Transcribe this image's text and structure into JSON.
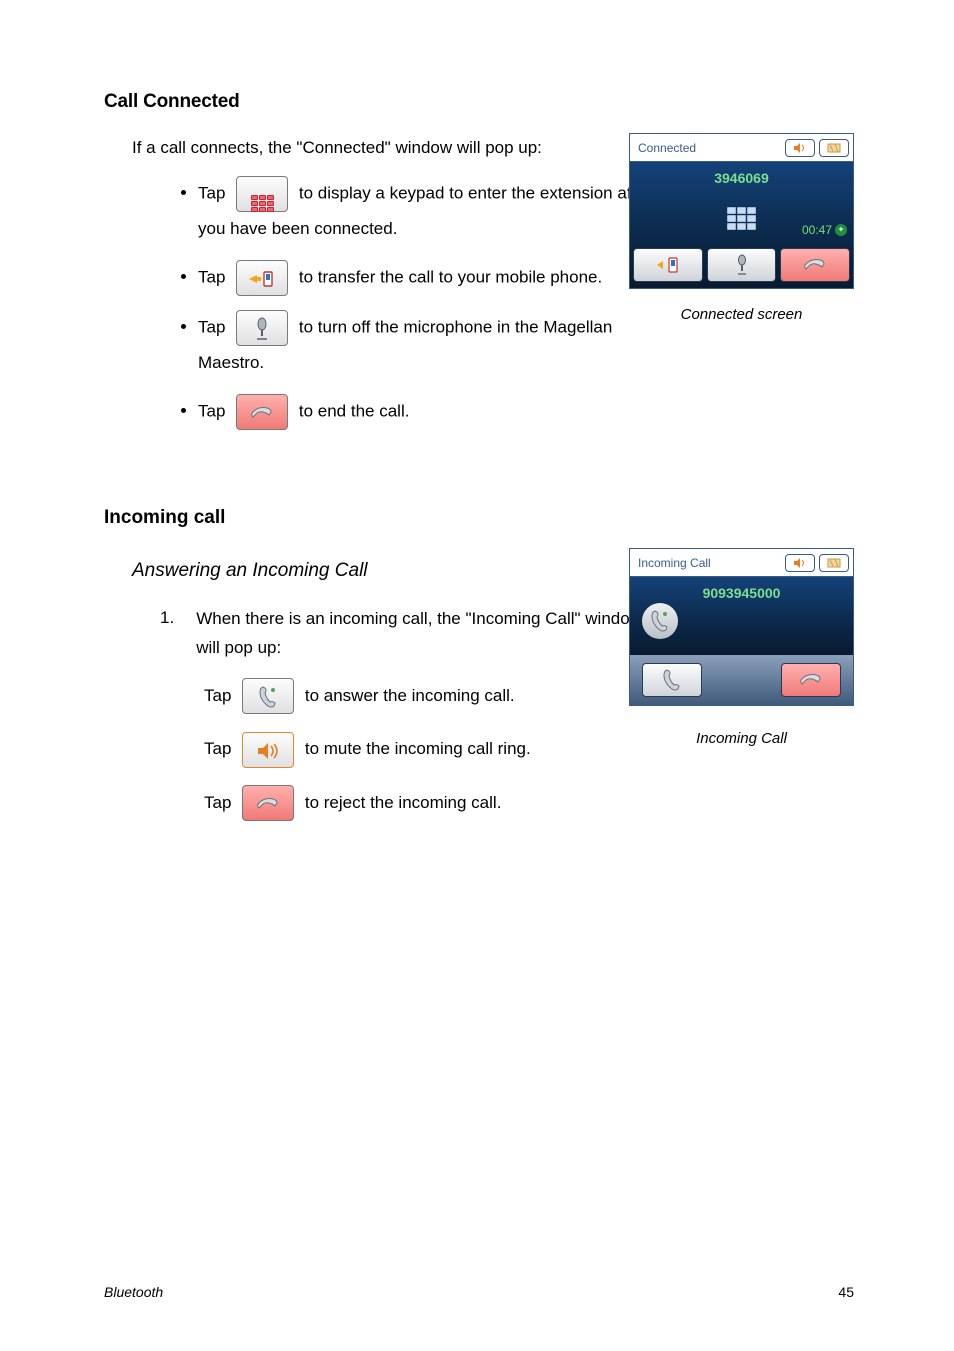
{
  "section1": {
    "heading": "Call Connected",
    "intro": "If a call connects, the \"Connected\" window will pop up:",
    "bullets": {
      "b1a": "Tap ",
      "b1b": " to display a keypad to enter the extension after you have been connected.",
      "b2a": "Tap ",
      "b2b": " to transfer the call to your mobile phone.",
      "b3a": "Tap ",
      "b3b": " to turn off the microphone in the Magellan Maestro.",
      "b4a": "Tap ",
      "b4b": " to end the call."
    },
    "screen": {
      "title": "Connected",
      "number": "3946069",
      "timer": "00:47"
    },
    "caption": "Connected screen"
  },
  "section2": {
    "heading": "Incoming call",
    "subheading": "Answering an Incoming Call",
    "step1_num": "1.",
    "step1_text": "When there is an incoming call, the \"Incoming Call\" window will pop up:",
    "sub_a_pre": "Tap ",
    "sub_a_post": " to answer the incoming call.",
    "sub_b_pre": "Tap ",
    "sub_b_post": " to mute the incoming call ring.",
    "sub_c_pre": "Tap ",
    "sub_c_post": " to reject the incoming call.",
    "screen": {
      "title": "Incoming Call",
      "number": "9093945000"
    },
    "caption": "Incoming Call"
  },
  "footer": {
    "section": "Bluetooth",
    "page": "45"
  }
}
